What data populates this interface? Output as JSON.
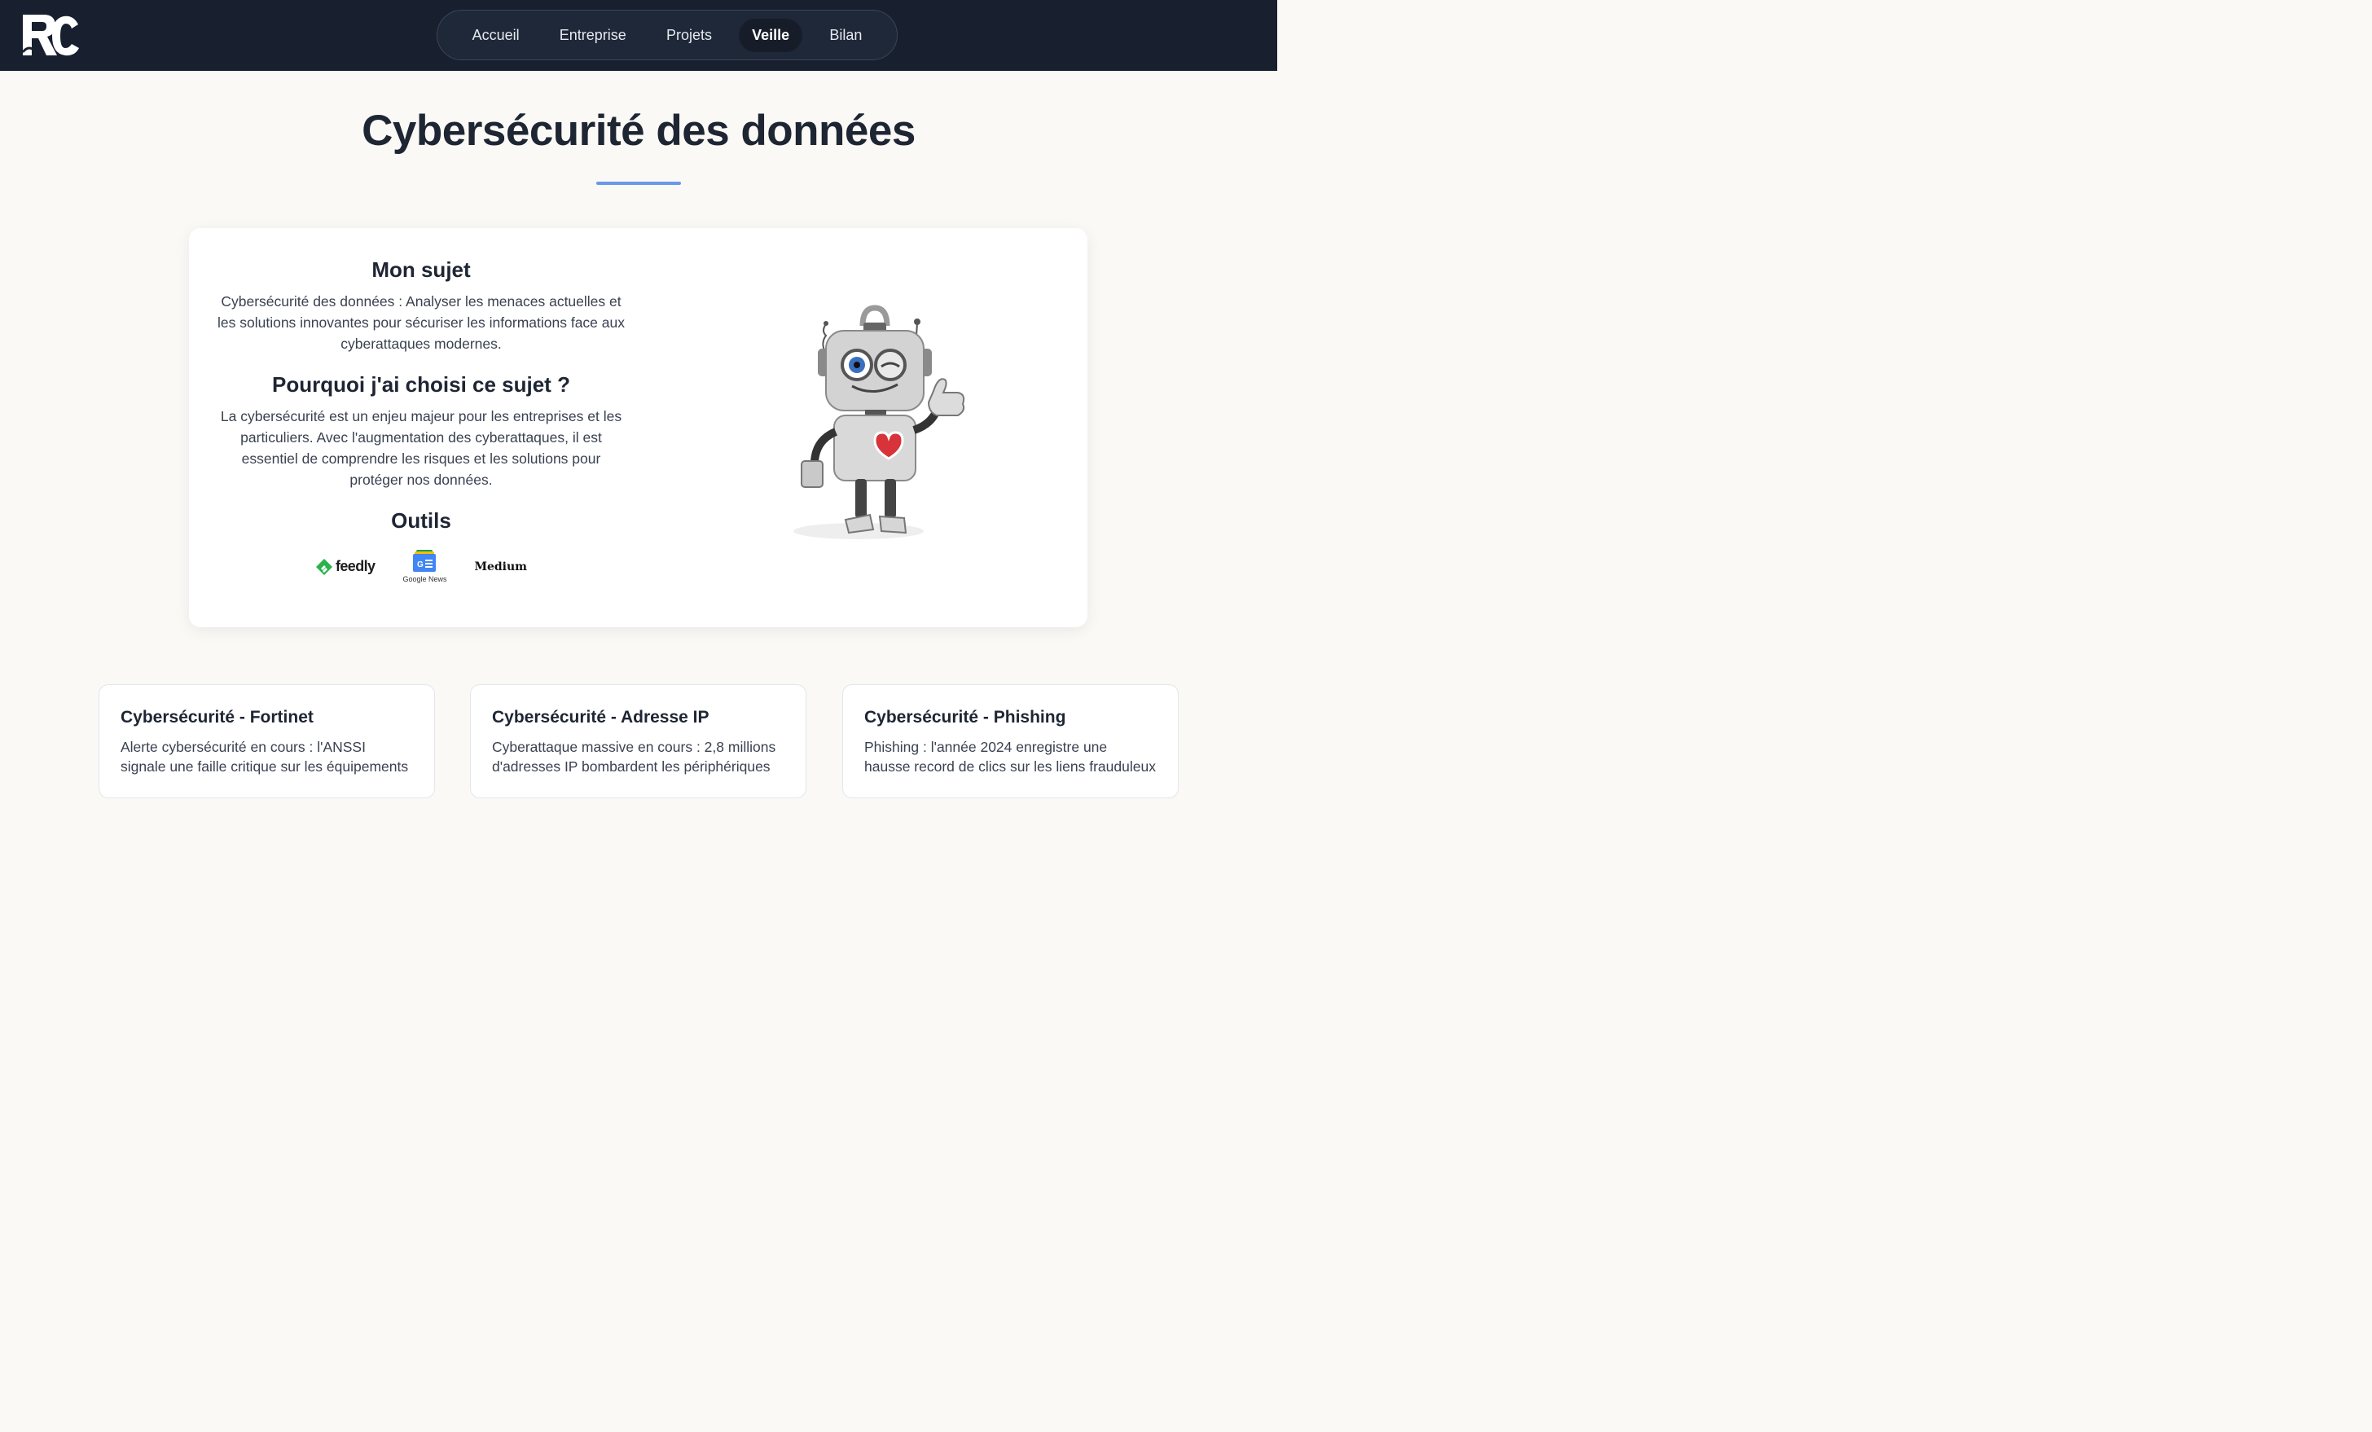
{
  "nav": {
    "items": [
      {
        "label": "Accueil",
        "active": false
      },
      {
        "label": "Entreprise",
        "active": false
      },
      {
        "label": "Projets",
        "active": false
      },
      {
        "label": "Veille",
        "active": true
      },
      {
        "label": "Bilan",
        "active": false
      }
    ]
  },
  "logo": {
    "icon": "rc-monogram-logo"
  },
  "page": {
    "title": "Cybersécurité des données"
  },
  "intro": {
    "subject_heading": "Mon sujet",
    "subject_text": "Cybersécurité des données : Analyser les menaces actuelles et les solutions innovantes pour sécuriser les informations face aux cyberattaques modernes.",
    "why_heading": "Pourquoi j'ai choisi ce sujet ?",
    "why_text": "La cybersécurité est un enjeu majeur pour les entreprises et les particuliers. Avec l'augmentation des cyberattaques, il est essentiel de comprendre les risques et les solutions pour protéger nos données.",
    "tools_heading": "Outils",
    "tools": {
      "feedly": "feedly",
      "google_news": "Google News",
      "medium": "Medium"
    },
    "illustration": "robot-thumbs-up-icon"
  },
  "articles": [
    {
      "title": "Cybersécurité - Fortinet",
      "text": "Alerte cybersécurité en cours : l'ANSSI signale une faille critique sur les équipements"
    },
    {
      "title": "Cybersécurité - Adresse IP",
      "text": "Cyberattaque massive en cours : 2,8 millions d'adresses IP bombardent les périphériques"
    },
    {
      "title": "Cybersécurité - Phishing",
      "text": "Phishing : l'année 2024 enregistre une hausse record de clics sur les liens frauduleux"
    }
  ],
  "colors": {
    "header_bg": "#18202f",
    "accent": "#6a98e8",
    "page_bg": "#faf9f6",
    "heart": "#d8323a"
  }
}
